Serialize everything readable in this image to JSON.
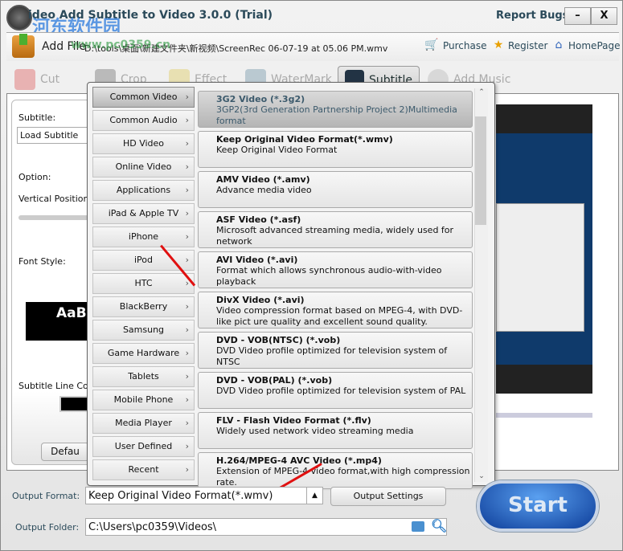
{
  "window": {
    "title": "ideo Add Subtitle to Video 3.0.0 (Trial)",
    "report_bugs": "Report Bugs",
    "minimize": "–",
    "close": "X"
  },
  "watermark": {
    "text": "河东软件园",
    "url": "www.pc0359.cn"
  },
  "topbar": {
    "add_file": "Add File",
    "path": "D:\\tools\\桌面\\新建文件夹\\新视频\\ScreenRec 06-07-19 at 05.06 PM.wmv",
    "purchase": "Purchase",
    "register": "Register",
    "homepage": "HomePage"
  },
  "tabs": [
    {
      "label": "Cut"
    },
    {
      "label": "Crop"
    },
    {
      "label": "Effect"
    },
    {
      "label": "WaterMark"
    },
    {
      "label": "Subtitle"
    },
    {
      "label": "Add Music"
    }
  ],
  "left": {
    "subtitle_label": "Subtitle:",
    "subtitle_value": "Load Subtitle",
    "option_label": "Option:",
    "vertical_label": "Vertical Position:",
    "font_style_label": "Font Style:",
    "font_preview": "AaB",
    "line_color_label": "Subtitle Line Color",
    "default_button": "Defau"
  },
  "categories": [
    "Common Video",
    "Common Audio",
    "HD Video",
    "Online Video",
    "Applications",
    "iPad & Apple TV",
    "iPhone",
    "iPod",
    "HTC",
    "BlackBerry",
    "Samsung",
    "Game Hardware",
    "Tablets",
    "Mobile Phone",
    "Media Player",
    "User Defined",
    "Recent"
  ],
  "formats": [
    {
      "name": "3G2 Video (*.3g2)",
      "desc": "3GP2(3rd Generation Partnership Project 2)Multimedia format"
    },
    {
      "name": "Keep Original Video Format(*.wmv)",
      "desc": "Keep Original Video Format"
    },
    {
      "name": "AMV Video (*.amv)",
      "desc": "Advance media video"
    },
    {
      "name": "ASF Video (*.asf)",
      "desc": "Microsoft advanced streaming media, widely used for network"
    },
    {
      "name": "AVI Video (*.avi)",
      "desc": "Format which allows synchronous audio-with-video playback"
    },
    {
      "name": "DivX Video (*.avi)",
      "desc": "Video compression format based on MPEG-4, with DVD-like pict ure quality and excellent sound quality."
    },
    {
      "name": "DVD - VOB(NTSC) (*.vob)",
      "desc": "DVD Video profile optimized for television system of NTSC"
    },
    {
      "name": "DVD - VOB(PAL) (*.vob)",
      "desc": "DVD Video profile optimized for television system of PAL"
    },
    {
      "name": "FLV - Flash Video Format (*.flv)",
      "desc": "Widely used network video streaming media"
    },
    {
      "name": "H.264/MPEG-4 AVC Video (*.mp4)",
      "desc": "Extension of MPEG-4 video format,with high compression rate."
    }
  ],
  "bottom": {
    "output_format_label": "Output Format:",
    "output_format_value": "Keep Original Video Format(*.wmv)",
    "output_settings": "Output Settings",
    "output_folder_label": "Output Folder:",
    "output_folder_value": "C:\\Users\\pc0359\\Videos\\",
    "start": "Start"
  }
}
